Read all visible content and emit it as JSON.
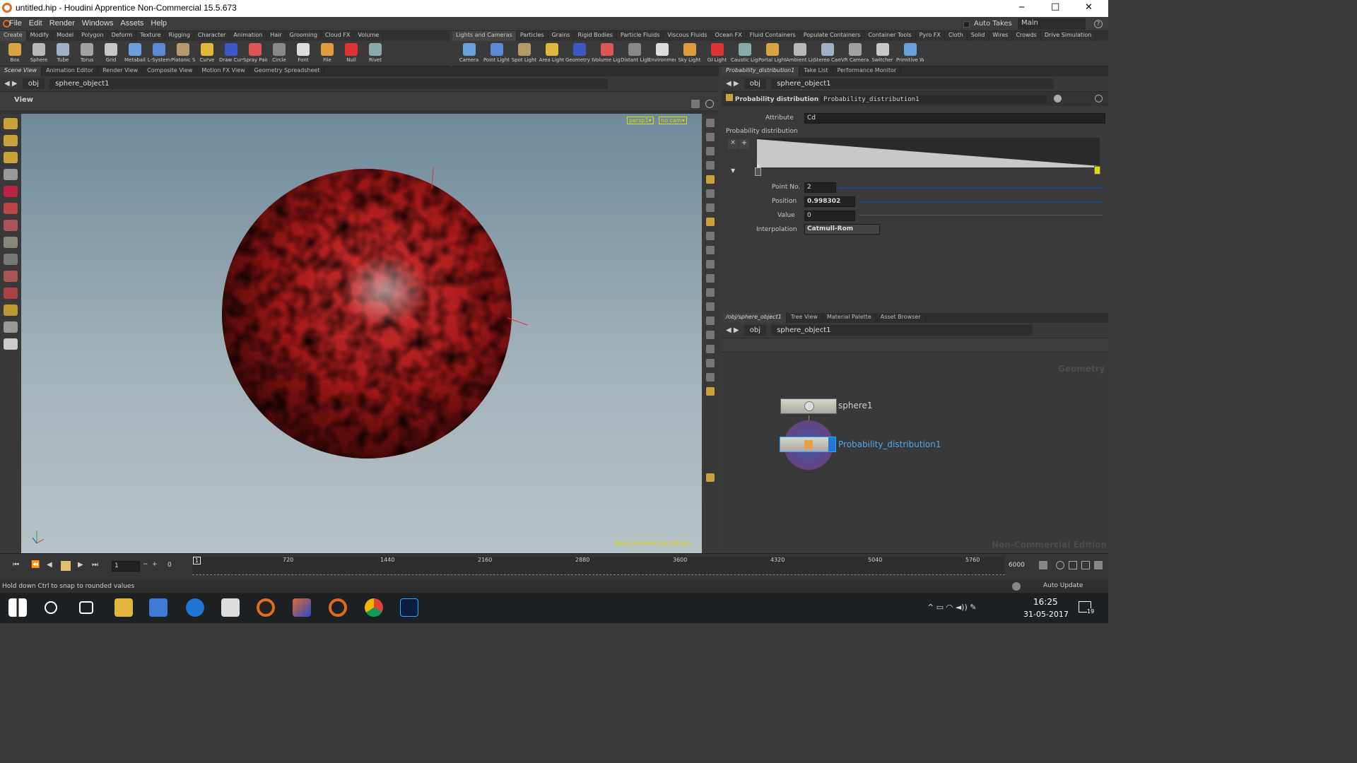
{
  "window": {
    "title": "untitled.hip - Houdini Apprentice Non-Commercial 15.5.673",
    "minimize": "─",
    "maximize": "□",
    "close": "✕"
  },
  "menu": [
    "File",
    "Edit",
    "Render",
    "Windows",
    "Assets",
    "Help"
  ],
  "auto_takes": "Auto Takes",
  "desktop": "Main",
  "shelf_left": {
    "tabs": [
      "Create",
      "Modify",
      "Model",
      "Polygon",
      "Deform",
      "Texture",
      "Rigging",
      "Character",
      "Animation",
      "Hair",
      "Grooming",
      "Cloud FX",
      "Volume"
    ],
    "tools": [
      "Box",
      "Sphere",
      "Tube",
      "Torus",
      "Grid",
      "Metaball",
      "L-System",
      "Platonic Sol...",
      "Curve",
      "Draw Curve",
      "Spray Paint",
      "Circle",
      "Font",
      "File",
      "Null",
      "Rivet"
    ]
  },
  "shelf_right": {
    "tabs": [
      "Lights and Cameras",
      "Particles",
      "Grains",
      "Rigid Bodies",
      "Particle Fluids",
      "Viscous Fluids",
      "Ocean FX",
      "Fluid Containers",
      "Populate Containers",
      "Container Tools",
      "Pyro FX",
      "Cloth",
      "Solid",
      "Wires",
      "Crowds",
      "Drive Simulation"
    ],
    "tools": [
      "Camera",
      "Point Light",
      "Spot Light",
      "Area Light",
      "Geometry L...",
      "Volume Light",
      "Distant Light",
      "Environmen...",
      "Sky Light",
      "GI Light",
      "Caustic Light",
      "Portal Light",
      "Ambient Lig...",
      "Stereo Cam...",
      "VR Camera",
      "Switcher",
      "Primitive W..."
    ]
  },
  "viewer": {
    "tabs": [
      "Scene View",
      "Animation Editor",
      "Render View",
      "Composite View",
      "Motion FX View",
      "Geometry Spreadsheet"
    ],
    "path_obj": "obj",
    "path_node": "sphere_object1",
    "title": "View",
    "cam": "persp1▾",
    "nocam": "no cam▾",
    "watermark": "Non-Commercial Edition"
  },
  "params": {
    "tabs": [
      "Probability_distribution1",
      "Take List",
      "Performance Monitor"
    ],
    "path_obj": "obj",
    "path_node": "sphere_object1",
    "node_type": "Probability distribution",
    "node_name": "Probability_distribution1",
    "attribute_label": "Attribute",
    "attribute_value": "Cd",
    "ramp_label": "Probability distribution",
    "point_no_label": "Point No.",
    "point_no": "2",
    "position_label": "Position",
    "position": "0.998302",
    "value_label": "Value",
    "value": "0",
    "interp_label": "Interpolation",
    "interp": "Catmull-Rom"
  },
  "network": {
    "tabs": [
      "/obj/sphere_object1",
      "Tree View",
      "Material Palette",
      "Asset Browser"
    ],
    "path_obj": "obj",
    "path_node": "sphere_object1",
    "context": "Geometry",
    "watermark": "Non-Commercial Edition",
    "node1": "sphere1",
    "node2": "Probability_distribution1"
  },
  "timeline": {
    "frame": "1",
    "start": "1",
    "end_field": "0",
    "ticks": [
      "720",
      "1440",
      "2160",
      "2880",
      "3600",
      "4320",
      "5040",
      "5760"
    ],
    "end": "6000",
    "marker": "1"
  },
  "status": {
    "text": "Hold down Ctrl to snap to rounded values",
    "auto_update": "Auto Update"
  },
  "taskbar": {
    "time": "16:25",
    "date": "31-05-2017",
    "notif": "19"
  }
}
